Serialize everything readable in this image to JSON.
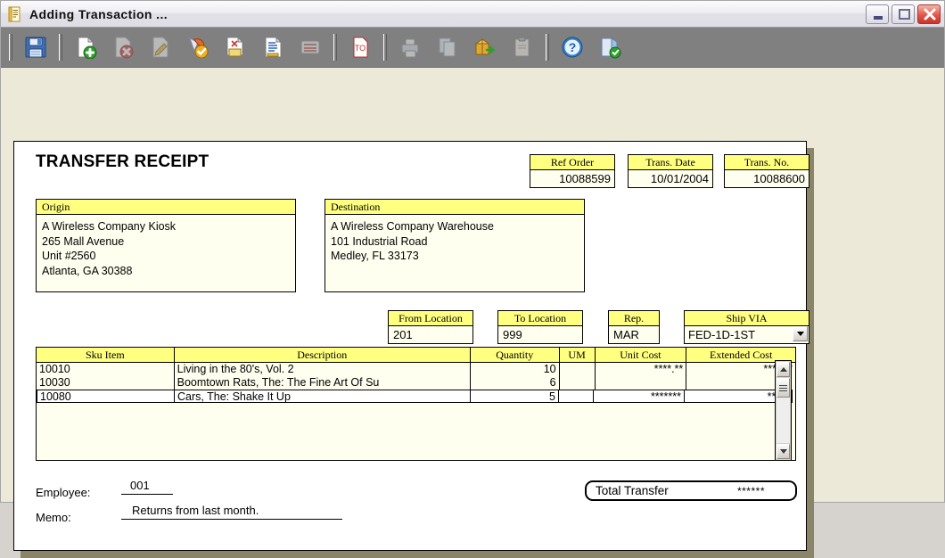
{
  "window": {
    "title": "Adding Transaction ...",
    "title_icon": "document-icon",
    "minimize_label": "Minimize",
    "maximize_label": "Maximize",
    "close_label": "Close"
  },
  "toolbar": {
    "buttons": [
      {
        "name": "save-icon",
        "label": "Save",
        "enabled": true
      },
      {
        "name": "new-record-icon",
        "label": "New",
        "enabled": true
      },
      {
        "name": "delete-record-icon",
        "label": "Delete",
        "enabled": false
      },
      {
        "name": "edit-record-icon",
        "label": "Edit",
        "enabled": false
      },
      {
        "name": "post-icon",
        "label": "Post",
        "enabled": true
      },
      {
        "name": "attach-note-icon",
        "label": "Notes",
        "enabled": true
      },
      {
        "name": "list-view-icon",
        "label": "List",
        "enabled": true
      },
      {
        "name": "calculator-icon",
        "label": "Calculate",
        "enabled": false
      },
      {
        "name": "totals-icon",
        "label": "Totals",
        "enabled": true
      },
      {
        "name": "print-icon",
        "label": "Print",
        "enabled": false
      },
      {
        "name": "copy-icon",
        "label": "Copy",
        "enabled": false
      },
      {
        "name": "package-ship-icon",
        "label": "Ship",
        "enabled": true
      },
      {
        "name": "clipboard-icon",
        "label": "Clipboard",
        "enabled": false
      },
      {
        "name": "help-icon",
        "label": "Help",
        "enabled": true
      },
      {
        "name": "exit-icon",
        "label": "Exit",
        "enabled": true
      }
    ]
  },
  "form": {
    "title": "TRANSFER RECEIPT",
    "header_fields": [
      {
        "name": "ref-order",
        "label": "Ref Order",
        "value": "10088599"
      },
      {
        "name": "trans-date",
        "label": "Trans. Date",
        "value": "10/01/2004"
      },
      {
        "name": "trans-no",
        "label": "Trans. No.",
        "value": "10088600"
      }
    ],
    "origin": {
      "label": "Origin",
      "lines": [
        "A Wireless Company Kiosk",
        "265 Mall Avenue",
        "Unit #2560",
        "Atlanta, GA 30388"
      ]
    },
    "destination": {
      "label": "Destination",
      "lines": [
        "A Wireless Company Warehouse",
        "101 Industrial Road",
        "Medley, FL 33173"
      ]
    },
    "routing": {
      "from_location": {
        "label": "From Location",
        "value": "201"
      },
      "to_location": {
        "label": "To Location",
        "value": "999"
      },
      "rep": {
        "label": "Rep.",
        "value": "MAR",
        "selected": true
      },
      "ship_via": {
        "label": "Ship VIA",
        "value": "FED-1D-1ST"
      }
    },
    "grid": {
      "columns": [
        "Sku Item",
        "Description",
        "Quantity",
        "UM",
        "Unit Cost",
        "Extended Cost"
      ],
      "rows": [
        {
          "sku": "10010",
          "description": "Living in the 80's, Vol. 2",
          "quantity": "10",
          "um": "",
          "unit_cost": "****.**",
          "extended_cost": "****.**",
          "active": false
        },
        {
          "sku": "10030",
          "description": "Boomtown Rats, The: The Fine Art Of Su",
          "quantity": "6",
          "um": "",
          "unit_cost": "",
          "extended_cost": "",
          "active": false
        },
        {
          "sku": "10080",
          "description": "Cars, The: Shake It Up",
          "quantity": "5",
          "um": "",
          "unit_cost": "*******",
          "extended_cost": "*****",
          "active": true
        }
      ],
      "scrollbar": {
        "up": "scroll-up",
        "thumb": "scroll-thumb",
        "down": "scroll-down"
      }
    },
    "footer": {
      "employee_label": "Employee:",
      "employee_value": "001",
      "memo_label": "Memo:",
      "memo_value": "Returns from last month.",
      "total_label": "Total Transfer",
      "total_value": "******"
    }
  },
  "colors": {
    "caption_yellow": "#ffff80",
    "field_cream": "#fffff0",
    "toolbar_gray": "#808080",
    "desk_beige": "#ece9d8"
  }
}
